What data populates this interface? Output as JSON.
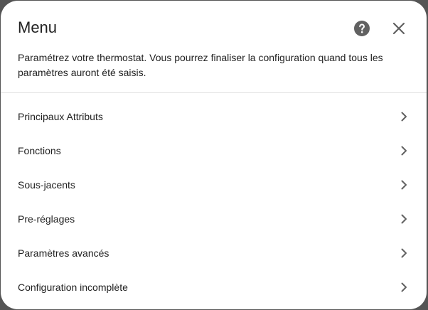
{
  "dialog": {
    "title": "Menu",
    "description": "Paramétrez votre thermostat. Vous pourrez finaliser la configuration quand tous les paramètres auront été saisis.",
    "help_icon": "help-circle-icon",
    "close_icon": "close-icon"
  },
  "menu": {
    "items": [
      {
        "label": "Principaux Attributs",
        "icon": "chevron-right-icon"
      },
      {
        "label": "Fonctions",
        "icon": "chevron-right-icon"
      },
      {
        "label": "Sous-jacents",
        "icon": "chevron-right-icon"
      },
      {
        "label": "Pre-réglages",
        "icon": "chevron-right-icon"
      },
      {
        "label": "Paramètres avancés",
        "icon": "chevron-right-icon"
      },
      {
        "label": "Configuration incomplète",
        "icon": "chevron-right-icon"
      }
    ]
  },
  "colors": {
    "text": "#212121",
    "icon": "#5f5f5f",
    "divider": "#e0e0e0",
    "surface": "#ffffff"
  }
}
